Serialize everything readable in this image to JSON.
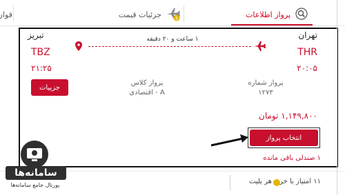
{
  "tabs": {
    "flight_info": "پرواز اطلاعات",
    "price_details": "جزئیات قیمت",
    "rules_partial": "قوان"
  },
  "flight": {
    "origin_city": "تهران",
    "origin_code": "THR",
    "origin_time": "۲۰:۰۵",
    "dest_city": "تبریز",
    "dest_code": "TBZ",
    "dest_time": "۲۱:۲۵",
    "duration": "۱ ساعت و ۲۰ دقیقه",
    "flight_number_label": "پرواز شماره",
    "flight_number": "۱۲۷۳",
    "class_label": "پرواز کلاس",
    "class_value": "A - اقتصادی",
    "details_button": "جزییات"
  },
  "booking": {
    "price": "۱,۱۴۹,۸۰۰ تومان",
    "select_button": "انتخاب پرواز",
    "seats_left": "۱ صندلی باقی مانده"
  },
  "footer": {
    "points_text": "۱۱ امتیاز با خرید هر بلیت"
  },
  "watermark": {
    "brand": "سامانه‌ها",
    "subtitle": "پورتال جامع سامانه‌ها"
  },
  "colors": {
    "accent": "#c8102e",
    "border": "#111111"
  },
  "icons": {
    "flight_info": "search-icon",
    "price_details": "plane-dollar-icon",
    "origin": "plane-icon",
    "destination": "location-pin-icon",
    "points": "coin-icon"
  }
}
